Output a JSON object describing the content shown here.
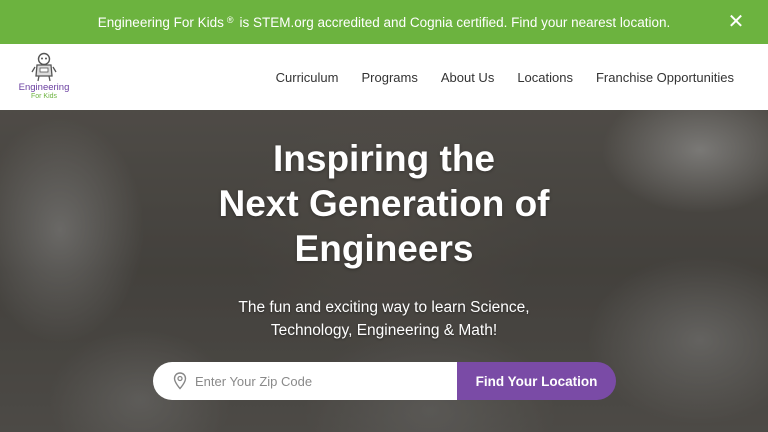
{
  "announcement": {
    "brand": "Engineering For Kids",
    "reg_mark": "®",
    "message": "is STEM.org accredited and Cognia certified. Find your nearest location.",
    "close_symbol": "✕",
    "bg_color": "#6cb33f"
  },
  "logo": {
    "line1": "Engineering",
    "line2": "For Kids"
  },
  "nav": {
    "items": [
      {
        "label": "Curriculum"
      },
      {
        "label": "Programs"
      },
      {
        "label": "About Us"
      },
      {
        "label": "Locations"
      },
      {
        "label": "Franchise Opportunities"
      }
    ]
  },
  "hero": {
    "headline": [
      "Inspiring the",
      "Next Generation of",
      "Engineers"
    ],
    "subtext": [
      "The fun and exciting way to learn Science,",
      "Technology, Engineering & Math!"
    ],
    "search": {
      "placeholder": "Enter Your Zip Code",
      "value": "",
      "button_label": "Find Your Location",
      "button_color": "#7a4ba6"
    }
  },
  "icons": {
    "close": "close-icon",
    "location": "location-pin-icon"
  }
}
